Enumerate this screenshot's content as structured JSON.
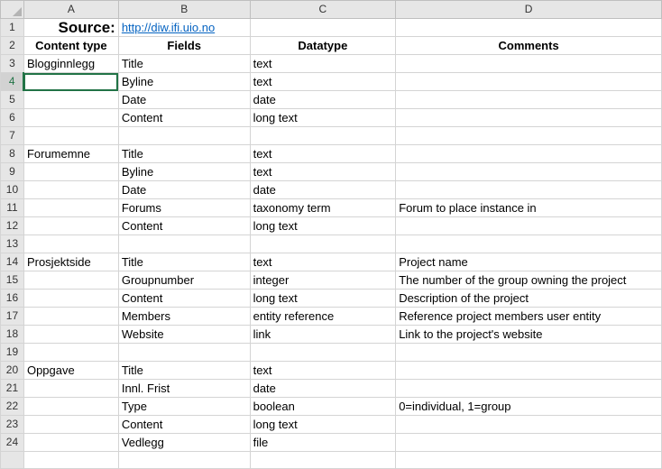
{
  "columns": [
    "A",
    "B",
    "C",
    "D"
  ],
  "source": {
    "label": "Source:",
    "url": "http://diw.ifi.uio.no"
  },
  "headers": {
    "content_type": "Content type",
    "fields": "Fields",
    "datatype": "Datatype",
    "comments": "Comments"
  },
  "rows": [
    {
      "n": "1"
    },
    {
      "n": "2"
    },
    {
      "n": "3",
      "a": "Blogginnlegg",
      "b": "Title",
      "c": "text",
      "d": ""
    },
    {
      "n": "4",
      "a": "",
      "b": "Byline",
      "c": "text",
      "d": ""
    },
    {
      "n": "5",
      "a": "",
      "b": "Date",
      "c": "date",
      "d": ""
    },
    {
      "n": "6",
      "a": "",
      "b": "Content",
      "c": "long text",
      "d": ""
    },
    {
      "n": "7",
      "a": "",
      "b": "",
      "c": "",
      "d": ""
    },
    {
      "n": "8",
      "a": "Forumemne",
      "b": "Title",
      "c": "text",
      "d": ""
    },
    {
      "n": "9",
      "a": "",
      "b": "Byline",
      "c": "text",
      "d": ""
    },
    {
      "n": "10",
      "a": "",
      "b": "Date",
      "c": "date",
      "d": ""
    },
    {
      "n": "11",
      "a": "",
      "b": "Forums",
      "c": "taxonomy term",
      "d": "Forum to place instance in"
    },
    {
      "n": "12",
      "a": "",
      "b": "Content",
      "c": "long text",
      "d": ""
    },
    {
      "n": "13",
      "a": "",
      "b": "",
      "c": "",
      "d": ""
    },
    {
      "n": "14",
      "a": "Prosjektside",
      "b": "Title",
      "c": "text",
      "d": "Project name"
    },
    {
      "n": "15",
      "a": "",
      "b": "Groupnumber",
      "c": "integer",
      "d": "The number of the group owning the project"
    },
    {
      "n": "16",
      "a": "",
      "b": "Content",
      "c": "long text",
      "d": "Description of the project"
    },
    {
      "n": "17",
      "a": "",
      "b": "Members",
      "c": "entity reference",
      "d": "Reference project members user entity"
    },
    {
      "n": "18",
      "a": "",
      "b": "Website",
      "c": "link",
      "d": "Link to the project's website"
    },
    {
      "n": "19",
      "a": "",
      "b": "",
      "c": "",
      "d": ""
    },
    {
      "n": "20",
      "a": "Oppgave",
      "b": "Title",
      "c": "text",
      "d": ""
    },
    {
      "n": "21",
      "a": "",
      "b": "Innl. Frist",
      "c": "date",
      "d": ""
    },
    {
      "n": "22",
      "a": "",
      "b": "Type",
      "c": "boolean",
      "d": "0=individual, 1=group"
    },
    {
      "n": "23",
      "a": "",
      "b": "Content",
      "c": "long text",
      "d": ""
    },
    {
      "n": "24",
      "a": "",
      "b": "Vedlegg",
      "c": "file",
      "d": ""
    },
    {
      "n": "",
      "a": "",
      "b": "",
      "c": "",
      "d": ""
    }
  ],
  "selected_row": "4",
  "colors": {
    "accent": "#217346",
    "link": "#0563c1",
    "header_bg": "#e6e6e6"
  }
}
